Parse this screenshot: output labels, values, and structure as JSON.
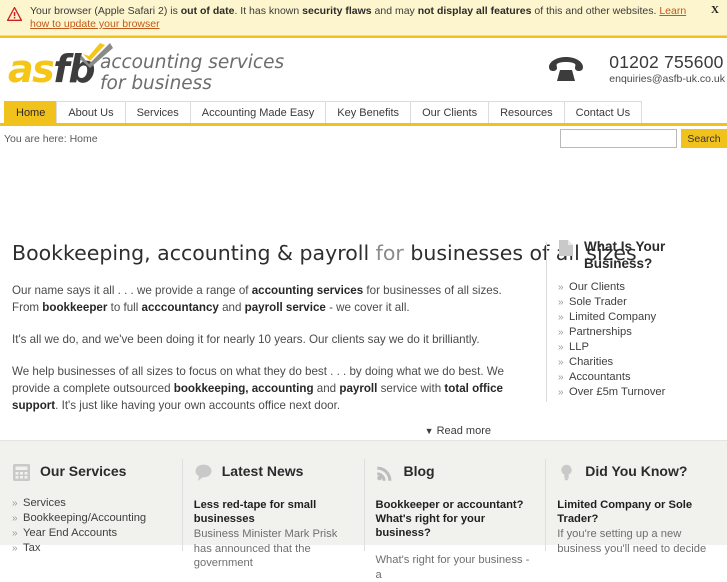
{
  "browser_warning": {
    "icon": "warning-triangle-icon",
    "text_1": "Your browser (Apple Safari 2) is ",
    "bold_1": "out of date",
    "text_2": ". It has known ",
    "bold_2": "security flaws",
    "text_3": " and may ",
    "bold_3": "not display all features",
    "text_4": " of this and other websites. ",
    "link": "Learn how to update your browser",
    "close_label": "X"
  },
  "header": {
    "logo": {
      "letters": "asfb",
      "tagline_line1": "accounting services",
      "tagline_line2": "for business",
      "tick_icon": "checkmark-icon",
      "color_yellow": "#f5c518",
      "color_dark": "#3d3d3d"
    },
    "contact": {
      "phone_icon": "telephone-icon",
      "phone": "01202 755600",
      "email": "enquiries@asfb-uk.co.uk"
    }
  },
  "nav": {
    "items": [
      {
        "label": "Home",
        "active": true
      },
      {
        "label": "About Us",
        "active": false
      },
      {
        "label": "Services",
        "active": false
      },
      {
        "label": "Accounting Made Easy",
        "active": false
      },
      {
        "label": "Key Benefits",
        "active": false
      },
      {
        "label": "Our Clients",
        "active": false
      },
      {
        "label": "Resources",
        "active": false
      },
      {
        "label": "Contact Us",
        "active": false
      }
    ],
    "accent_color": "#f2c21c"
  },
  "breadcrumb": {
    "text": "You are here: Home"
  },
  "search": {
    "value": "",
    "placeholder": "",
    "button_label": "Search"
  },
  "hero": {
    "heading_strong_1": "Bookkeeping, accounting & payroll",
    "heading_light": " for ",
    "heading_strong_2": "businesses of all sizes",
    "paragraph_1": {
      "t1": "Our name says it all . . . we provide a range of ",
      "b1": "accounting services",
      "t2": " for businesses of all sizes. From ",
      "b2": "bookkeeper",
      "t3": " to full ",
      "b3": "acccountancy",
      "t4": " and ",
      "b4": "payroll service",
      "t5": " - we cover it all."
    },
    "paragraph_2": "It's all we do, and we've been doing it for nearly 10 years. Our clients say we do it brilliantly.",
    "paragraph_3": {
      "t1": "We help businesses of all sizes to focus on what they do best . . . by doing what we do best. We provide a complete outsourced ",
      "b1": "bookkeeping, accounting",
      "t2": " and ",
      "b2": "payroll",
      "t3": " service with ",
      "b3": "total office support",
      "t4": ".  It's just like having your own accounts office next door."
    },
    "read_more": "Read more",
    "read_more_caret": "▼"
  },
  "sidebar": {
    "icon": "document-icon",
    "title": "What Is Your Business?",
    "items": [
      "Our Clients",
      "Sole Trader",
      "Limited Company",
      "Partnerships",
      "LLP",
      "Charities",
      "Accountants",
      "Over £5m Turnover"
    ],
    "bullet": "»"
  },
  "footer": {
    "columns": [
      {
        "icon": "calculator-icon",
        "title": "Our Services",
        "type": "links",
        "items": [
          "Services",
          "Bookkeeping/Accounting",
          "Year End Accounts",
          "Tax"
        ]
      },
      {
        "icon": "speech-bubble-icon",
        "title": "Latest News",
        "type": "feed",
        "entry_title": "Less red-tape for small businesses",
        "entry_body": "Business Minister Mark Prisk has announced that the government"
      },
      {
        "icon": "rss-icon",
        "title": "Blog",
        "type": "feed",
        "entry_title": "Bookkeeper or accountant? What's right for your business?",
        "entry_body": "What's right for your business - a"
      },
      {
        "icon": "lightbulb-icon",
        "title": "Did You Know?",
        "type": "feed",
        "entry_title": "Limited Company or Sole Trader?",
        "entry_body": "If you're setting up a new business you'll need to decide"
      }
    ],
    "bullet": "»"
  }
}
